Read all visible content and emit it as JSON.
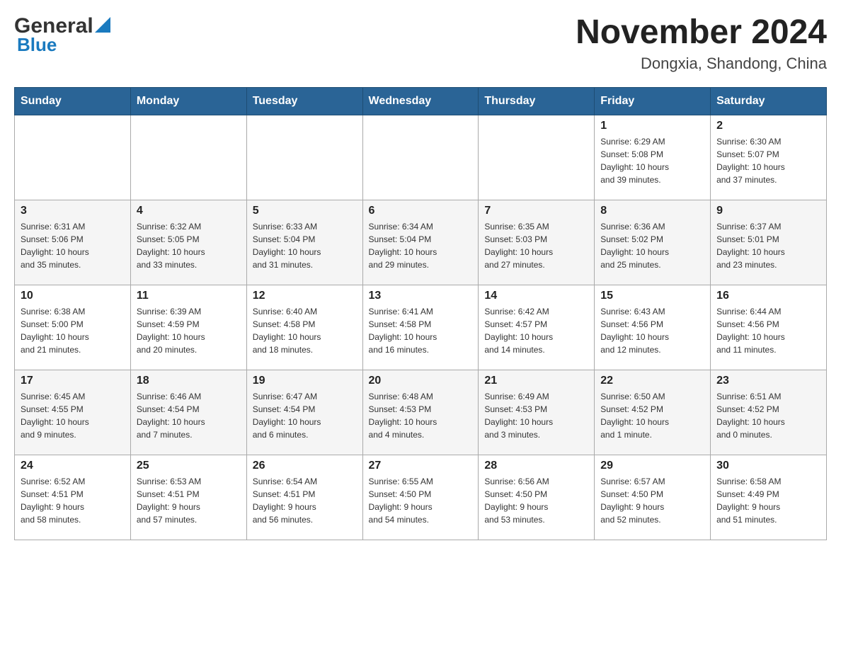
{
  "header": {
    "logo": {
      "general": "General",
      "blue": "Blue",
      "triangle_color": "#1a7abf"
    },
    "title": "November 2024",
    "location": "Dongxia, Shandong, China"
  },
  "calendar": {
    "days_of_week": [
      "Sunday",
      "Monday",
      "Tuesday",
      "Wednesday",
      "Thursday",
      "Friday",
      "Saturday"
    ],
    "weeks": [
      [
        {
          "day": "",
          "info": ""
        },
        {
          "day": "",
          "info": ""
        },
        {
          "day": "",
          "info": ""
        },
        {
          "day": "",
          "info": ""
        },
        {
          "day": "",
          "info": ""
        },
        {
          "day": "1",
          "info": "Sunrise: 6:29 AM\nSunset: 5:08 PM\nDaylight: 10 hours\nand 39 minutes."
        },
        {
          "day": "2",
          "info": "Sunrise: 6:30 AM\nSunset: 5:07 PM\nDaylight: 10 hours\nand 37 minutes."
        }
      ],
      [
        {
          "day": "3",
          "info": "Sunrise: 6:31 AM\nSunset: 5:06 PM\nDaylight: 10 hours\nand 35 minutes."
        },
        {
          "day": "4",
          "info": "Sunrise: 6:32 AM\nSunset: 5:05 PM\nDaylight: 10 hours\nand 33 minutes."
        },
        {
          "day": "5",
          "info": "Sunrise: 6:33 AM\nSunset: 5:04 PM\nDaylight: 10 hours\nand 31 minutes."
        },
        {
          "day": "6",
          "info": "Sunrise: 6:34 AM\nSunset: 5:04 PM\nDaylight: 10 hours\nand 29 minutes."
        },
        {
          "day": "7",
          "info": "Sunrise: 6:35 AM\nSunset: 5:03 PM\nDaylight: 10 hours\nand 27 minutes."
        },
        {
          "day": "8",
          "info": "Sunrise: 6:36 AM\nSunset: 5:02 PM\nDaylight: 10 hours\nand 25 minutes."
        },
        {
          "day": "9",
          "info": "Sunrise: 6:37 AM\nSunset: 5:01 PM\nDaylight: 10 hours\nand 23 minutes."
        }
      ],
      [
        {
          "day": "10",
          "info": "Sunrise: 6:38 AM\nSunset: 5:00 PM\nDaylight: 10 hours\nand 21 minutes."
        },
        {
          "day": "11",
          "info": "Sunrise: 6:39 AM\nSunset: 4:59 PM\nDaylight: 10 hours\nand 20 minutes."
        },
        {
          "day": "12",
          "info": "Sunrise: 6:40 AM\nSunset: 4:58 PM\nDaylight: 10 hours\nand 18 minutes."
        },
        {
          "day": "13",
          "info": "Sunrise: 6:41 AM\nSunset: 4:58 PM\nDaylight: 10 hours\nand 16 minutes."
        },
        {
          "day": "14",
          "info": "Sunrise: 6:42 AM\nSunset: 4:57 PM\nDaylight: 10 hours\nand 14 minutes."
        },
        {
          "day": "15",
          "info": "Sunrise: 6:43 AM\nSunset: 4:56 PM\nDaylight: 10 hours\nand 12 minutes."
        },
        {
          "day": "16",
          "info": "Sunrise: 6:44 AM\nSunset: 4:56 PM\nDaylight: 10 hours\nand 11 minutes."
        }
      ],
      [
        {
          "day": "17",
          "info": "Sunrise: 6:45 AM\nSunset: 4:55 PM\nDaylight: 10 hours\nand 9 minutes."
        },
        {
          "day": "18",
          "info": "Sunrise: 6:46 AM\nSunset: 4:54 PM\nDaylight: 10 hours\nand 7 minutes."
        },
        {
          "day": "19",
          "info": "Sunrise: 6:47 AM\nSunset: 4:54 PM\nDaylight: 10 hours\nand 6 minutes."
        },
        {
          "day": "20",
          "info": "Sunrise: 6:48 AM\nSunset: 4:53 PM\nDaylight: 10 hours\nand 4 minutes."
        },
        {
          "day": "21",
          "info": "Sunrise: 6:49 AM\nSunset: 4:53 PM\nDaylight: 10 hours\nand 3 minutes."
        },
        {
          "day": "22",
          "info": "Sunrise: 6:50 AM\nSunset: 4:52 PM\nDaylight: 10 hours\nand 1 minute."
        },
        {
          "day": "23",
          "info": "Sunrise: 6:51 AM\nSunset: 4:52 PM\nDaylight: 10 hours\nand 0 minutes."
        }
      ],
      [
        {
          "day": "24",
          "info": "Sunrise: 6:52 AM\nSunset: 4:51 PM\nDaylight: 9 hours\nand 58 minutes."
        },
        {
          "day": "25",
          "info": "Sunrise: 6:53 AM\nSunset: 4:51 PM\nDaylight: 9 hours\nand 57 minutes."
        },
        {
          "day": "26",
          "info": "Sunrise: 6:54 AM\nSunset: 4:51 PM\nDaylight: 9 hours\nand 56 minutes."
        },
        {
          "day": "27",
          "info": "Sunrise: 6:55 AM\nSunset: 4:50 PM\nDaylight: 9 hours\nand 54 minutes."
        },
        {
          "day": "28",
          "info": "Sunrise: 6:56 AM\nSunset: 4:50 PM\nDaylight: 9 hours\nand 53 minutes."
        },
        {
          "day": "29",
          "info": "Sunrise: 6:57 AM\nSunset: 4:50 PM\nDaylight: 9 hours\nand 52 minutes."
        },
        {
          "day": "30",
          "info": "Sunrise: 6:58 AM\nSunset: 4:49 PM\nDaylight: 9 hours\nand 51 minutes."
        }
      ]
    ]
  }
}
